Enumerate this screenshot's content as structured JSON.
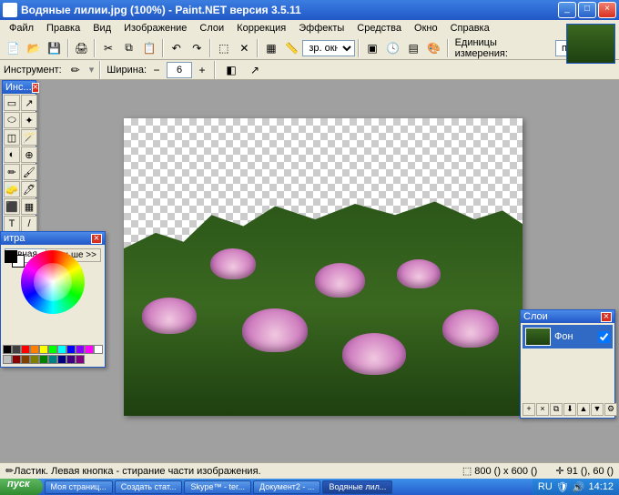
{
  "window": {
    "title": "Водяные лилии.jpg (100%) - Paint.NET версия 3.5.11"
  },
  "menu": [
    "Файл",
    "Правка",
    "Вид",
    "Изображение",
    "Слои",
    "Коррекция",
    "Эффекты",
    "Средства",
    "Окно",
    "Справка"
  ],
  "toolbar": {
    "view_label": "зр. окна",
    "units_label": "Единицы измерения:",
    "units_value": "пикселы"
  },
  "options": {
    "tool_label": "Инструмент:",
    "width_label": "Ширина:",
    "width_value": "6"
  },
  "tools_panel": {
    "title": "Инс..."
  },
  "colors_panel": {
    "title": "итра",
    "mode": "новная",
    "more": "Больше >>"
  },
  "layers_panel": {
    "title": "Слои",
    "layers": [
      {
        "name": "Фон",
        "visible": true
      }
    ]
  },
  "status": {
    "hint": "Ластик. Левая кнопка - стирание части изображения.",
    "size": "800 () x 600 ()",
    "pos": "91 (), 60 ()"
  },
  "taskbar": {
    "start": "пуск",
    "items": [
      "Моя страниц...",
      "Создать стат...",
      "Skype™ - ter...",
      "Документ2 - ...",
      "Водяные лил..."
    ],
    "lang": "RU",
    "time": "14:12"
  },
  "palette_colors": [
    "#000",
    "#404040",
    "#f00",
    "#ff8000",
    "#ff0",
    "#0f0",
    "#0ff",
    "#00f",
    "#80f",
    "#f0f",
    "#fff",
    "#c0c0c0",
    "#800",
    "#804000",
    "#808000",
    "#008000",
    "#008080",
    "#000080",
    "#400080",
    "#800080"
  ]
}
